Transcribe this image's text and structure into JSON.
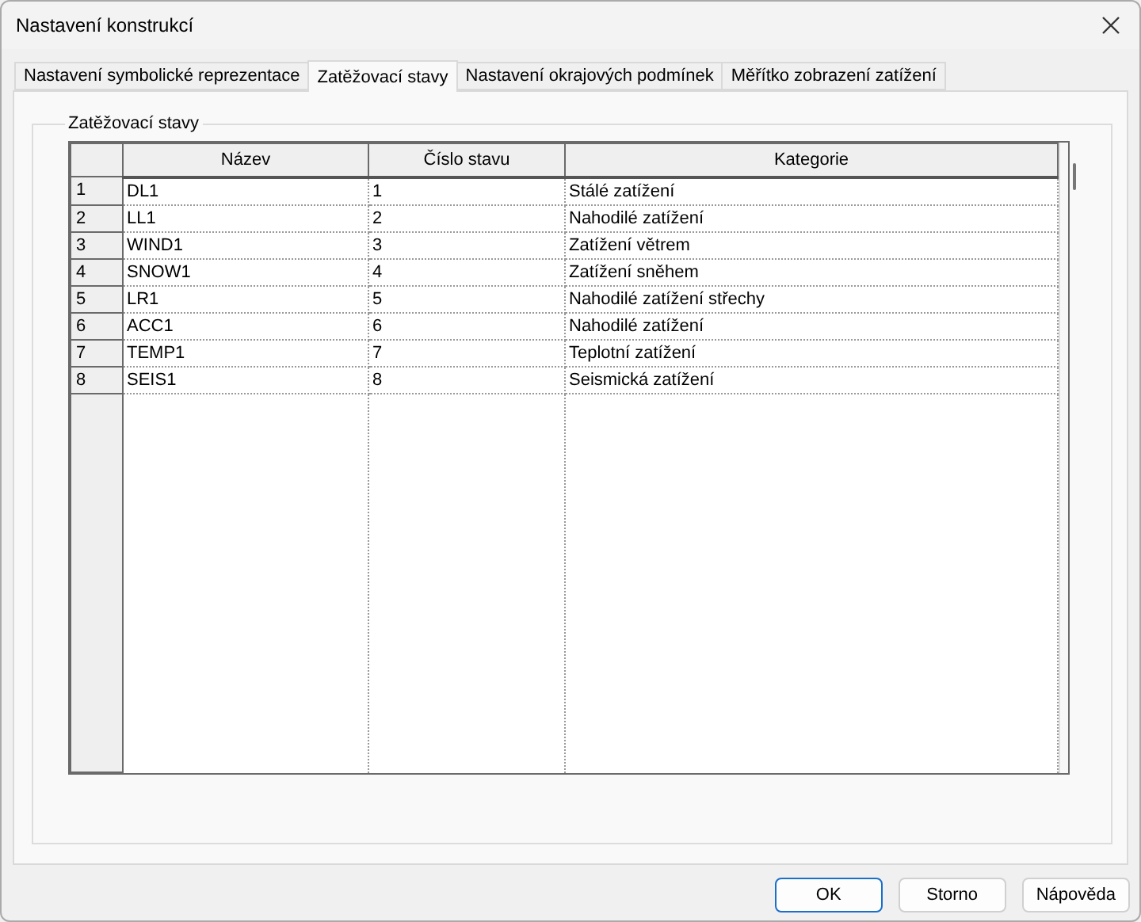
{
  "window": {
    "title": "Nastavení konstrukcí"
  },
  "tabs": [
    {
      "label": "Nastavení symbolické reprezentace",
      "selected": false
    },
    {
      "label": "Zatěžovací stavy",
      "selected": true
    },
    {
      "label": "Nastavení okrajových podmínek",
      "selected": false
    },
    {
      "label": "Měřítko zobrazení zatížení",
      "selected": false
    }
  ],
  "group": {
    "title": "Zatěžovací stavy"
  },
  "table": {
    "columns": [
      "Název",
      "Číslo stavu",
      "Kategorie"
    ],
    "rows": [
      {
        "header": "1",
        "cells": [
          "DL1",
          "1",
          "Stálé zatížení"
        ]
      },
      {
        "header": "2",
        "cells": [
          "LL1",
          "2",
          "Nahodilé zatížení"
        ]
      },
      {
        "header": "3",
        "cells": [
          "WIND1",
          "3",
          "Zatížení větrem"
        ]
      },
      {
        "header": "4",
        "cells": [
          "SNOW1",
          "4",
          "Zatížení sněhem"
        ]
      },
      {
        "header": "5",
        "cells": [
          "LR1",
          "5",
          "Nahodilé zatížení střechy"
        ]
      },
      {
        "header": "6",
        "cells": [
          "ACC1",
          "6",
          "Nahodilé zatížení"
        ]
      },
      {
        "header": "7",
        "cells": [
          "TEMP1",
          "7",
          "Teplotní zatížení"
        ]
      },
      {
        "header": "8",
        "cells": [
          "SEIS1",
          "8",
          "Seismická zatížení"
        ]
      }
    ]
  },
  "buttons": [
    {
      "label": "OK",
      "default": true
    },
    {
      "label": "Storno",
      "default": false
    },
    {
      "label": "Nápověda",
      "default": false
    }
  ]
}
